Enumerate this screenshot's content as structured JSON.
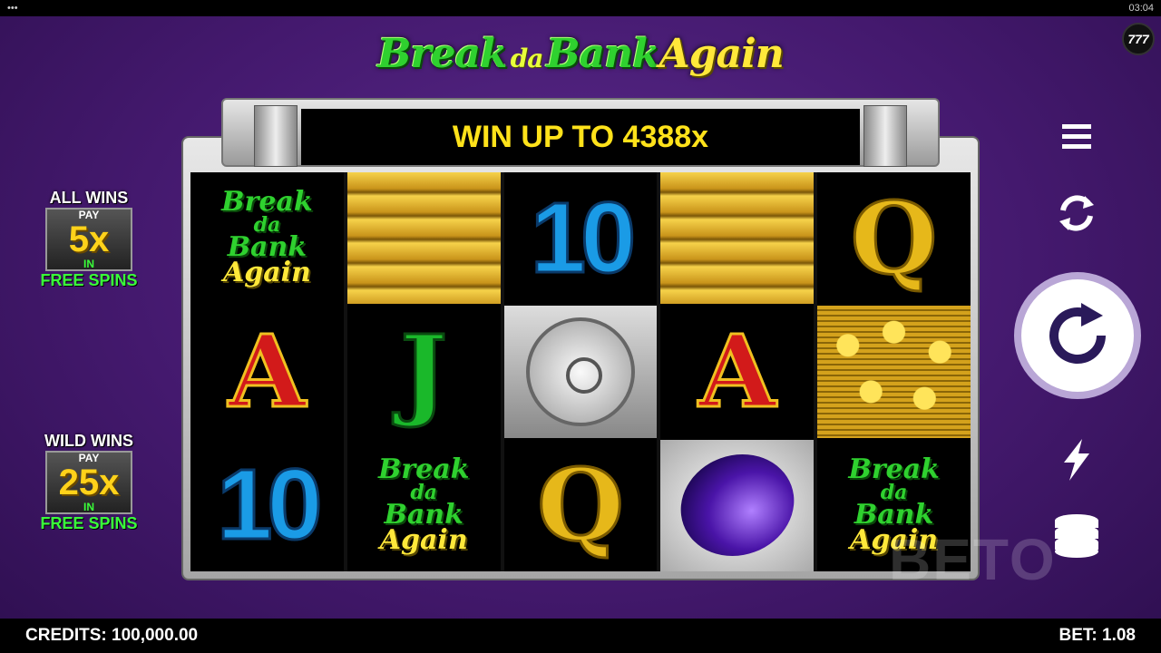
{
  "topbar": {
    "dots": "•••",
    "time": "03:04"
  },
  "logo": {
    "part1": "Break",
    "part2": "da",
    "part3": "Bank",
    "part4": "Again"
  },
  "badge": "777",
  "banner": "WIN UP TO 4388x",
  "reels": [
    [
      {
        "sym": "logo",
        "lines": [
          "Break",
          "da",
          "Bank",
          "Again"
        ]
      },
      {
        "sym": "A",
        "text": "A"
      },
      {
        "sym": "10",
        "text": "10"
      }
    ],
    [
      {
        "sym": "gold-bars"
      },
      {
        "sym": "J",
        "text": "J"
      },
      {
        "sym": "logo",
        "lines": [
          "Break",
          "da",
          "Bank",
          "Again"
        ]
      }
    ],
    [
      {
        "sym": "10",
        "text": "10"
      },
      {
        "sym": "vault"
      },
      {
        "sym": "Q",
        "text": "Q"
      }
    ],
    [
      {
        "sym": "gold-bars"
      },
      {
        "sym": "A",
        "text": "A"
      },
      {
        "sym": "gem"
      }
    ],
    [
      {
        "sym": "Q",
        "text": "Q"
      },
      {
        "sym": "coins"
      },
      {
        "sym": "logo",
        "lines": [
          "Break",
          "da",
          "Bank",
          "Again"
        ]
      }
    ]
  ],
  "all_wins": {
    "line1": "ALL WINS",
    "pay": "PAY",
    "mult": "5x",
    "in": "IN",
    "free": "FREE SPINS"
  },
  "wild_wins": {
    "line1": "WILD WINS",
    "pay": "PAY",
    "mult": "25x",
    "in": "IN",
    "free": "FREE SPINS"
  },
  "controls": {
    "menu_icon": "menu-icon",
    "autoplay_icon": "autoplay-icon",
    "spin_icon": "spin-icon",
    "turbo_icon": "lightning-icon",
    "bet_icon": "coin-stack-icon"
  },
  "credits": {
    "label": "CREDITS:",
    "value": "100,000.00"
  },
  "bet": {
    "label": "BET:",
    "value": "1.08"
  },
  "watermark": "BETO"
}
